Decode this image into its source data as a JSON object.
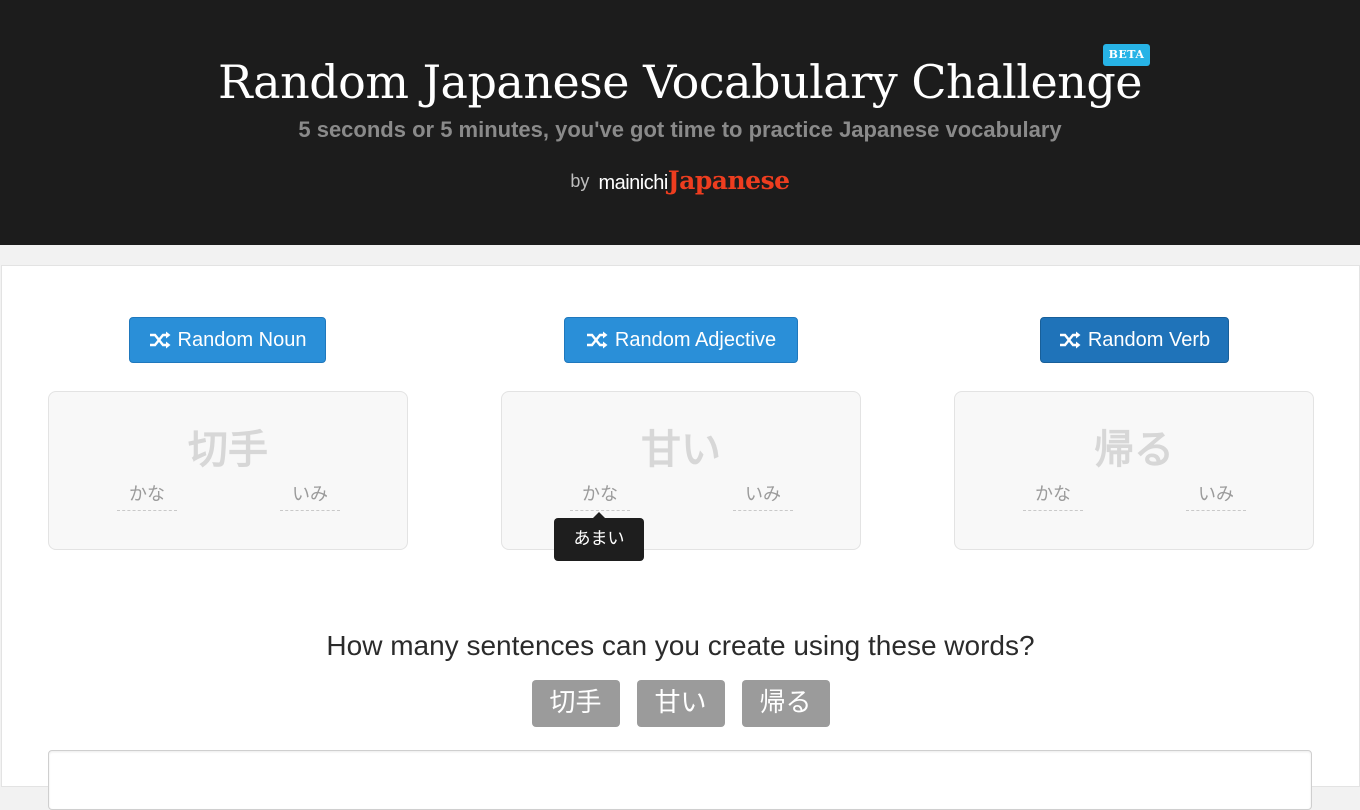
{
  "header": {
    "title": "Random Japanese Vocabulary Challenge",
    "badge": "BETA",
    "subtitle": "5 seconds or 5 minutes, you've got time to practice Japanese vocabulary",
    "by": "by",
    "brand_part1": "mainichi",
    "brand_part2": "Japanese"
  },
  "columns": [
    {
      "button_label": "Random Noun",
      "button_icon": "shuffle-icon",
      "word": "切手",
      "kana_label": "かな",
      "meaning_label": "いみ"
    },
    {
      "button_label": "Random Adjective",
      "button_icon": "shuffle-icon",
      "word": "甘い",
      "kana_label": "かな",
      "meaning_label": "いみ",
      "tooltip": "あまい"
    },
    {
      "button_label": "Random Verb",
      "button_icon": "shuffle-icon",
      "word": "帰る",
      "kana_label": "かな",
      "meaning_label": "いみ"
    }
  ],
  "challenge": {
    "question": "How many sentences can you create using these words?",
    "chips": [
      "切手",
      "甘い",
      "帰る"
    ]
  },
  "colors": {
    "header_bg": "#1c1c1c",
    "button_blue": "#2a8fd8",
    "button_blue_active": "#1f73b9",
    "brand_red": "#ee3d1f",
    "badge_blue": "#27b3e6",
    "chip_gray": "#9b9b9b"
  }
}
